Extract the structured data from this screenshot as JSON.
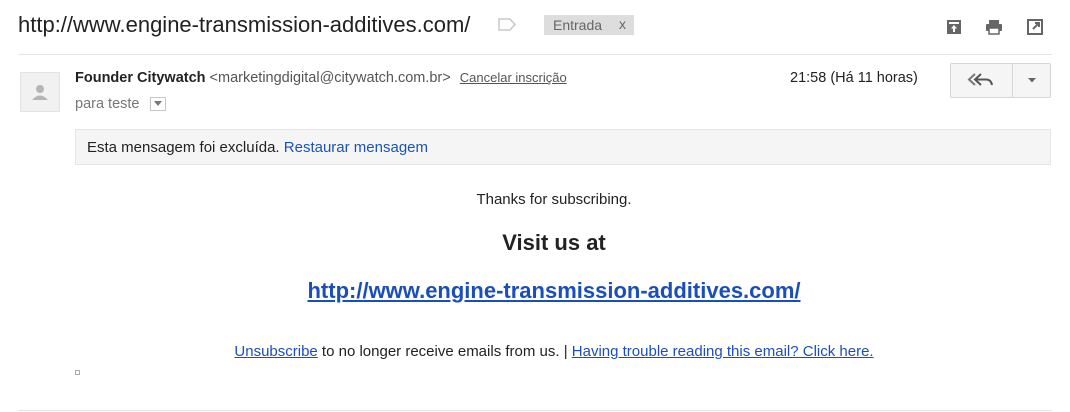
{
  "header": {
    "subject": "http://www.engine-transmission-additives.com/",
    "label_chip": "Entrada",
    "label_chip_remove": "x",
    "icons": [
      "label-tag-icon",
      "archive-icon",
      "print-icon",
      "open-new-window-icon"
    ]
  },
  "message": {
    "sender_name": "Founder Citywatch",
    "sender_email": "<marketingdigital@citywatch.com.br>",
    "unsubscribe_label": "Cancelar inscrição",
    "recipient": "para teste",
    "timestamp": "21:58 (Há 11 horas)",
    "deleted_notice": "Esta mensagem foi excluída.",
    "restore_label": "Restaurar mensagem"
  },
  "body": {
    "thanks": "Thanks for subscribing.",
    "visit": "Visit us at",
    "site_link": "http://www.engine-transmission-additives.com/",
    "footer_unsubscribe": "Unsubscribe",
    "footer_middle": " to no longer receive emails from us. | ",
    "footer_trouble": "Having trouble reading this email? Click here."
  },
  "colors": {
    "link": "#1a4fbb",
    "chip_bg": "#dddddd",
    "notice_bg": "#f5f5f5"
  }
}
